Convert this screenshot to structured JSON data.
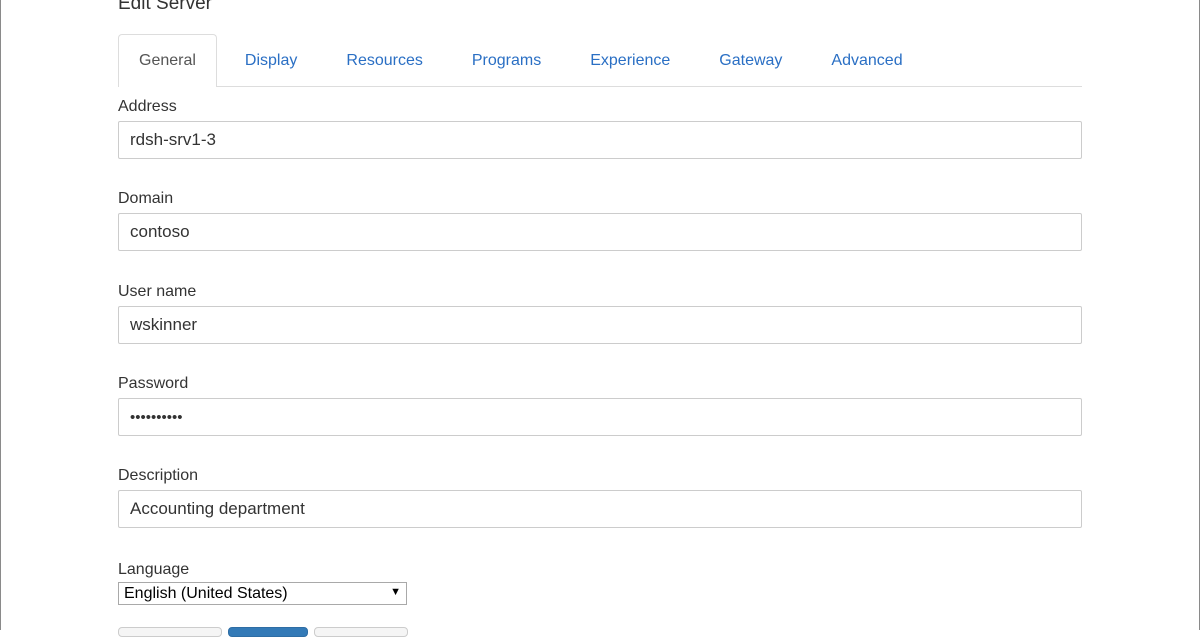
{
  "dialog": {
    "title": "Edit Server"
  },
  "tabs": [
    {
      "label": "General",
      "active": true
    },
    {
      "label": "Display",
      "active": false
    },
    {
      "label": "Resources",
      "active": false
    },
    {
      "label": "Programs",
      "active": false
    },
    {
      "label": "Experience",
      "active": false
    },
    {
      "label": "Gateway",
      "active": false
    },
    {
      "label": "Advanced",
      "active": false
    }
  ],
  "form": {
    "address": {
      "label": "Address",
      "value": "rdsh-srv1-3"
    },
    "domain": {
      "label": "Domain",
      "value": "contoso"
    },
    "username": {
      "label": "User name",
      "value": "wskinner"
    },
    "password": {
      "label": "Password",
      "value": "••••••••••"
    },
    "description": {
      "label": "Description",
      "value": "Accounting department"
    },
    "language": {
      "label": "Language",
      "selected": "English (United States)"
    }
  },
  "colors": {
    "link": "#2a6fc4",
    "primary_button": "#337ab7",
    "border": "#cccccc"
  }
}
